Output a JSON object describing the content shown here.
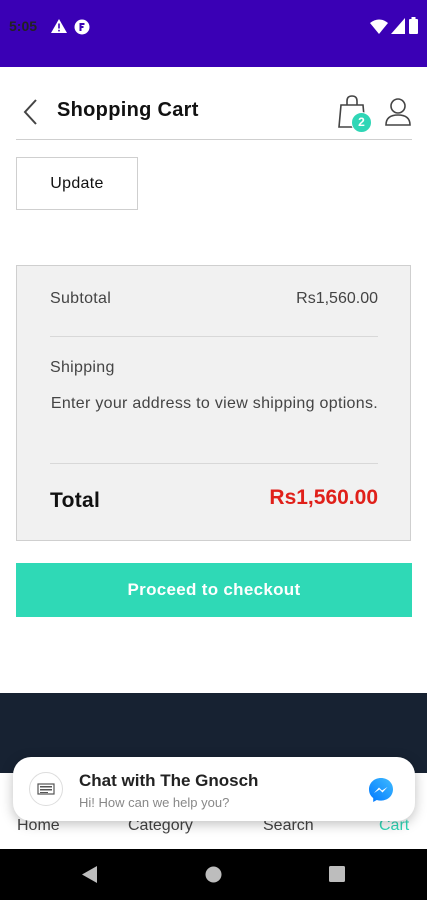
{
  "status_bar": {
    "time": "5:05"
  },
  "header": {
    "title": "Shopping Cart",
    "cart_count": "2"
  },
  "cart": {
    "update_label": "Update"
  },
  "totals": {
    "subtotal_label": "Subtotal",
    "subtotal_value": "Rs1,560.00",
    "shipping_label": "Shipping",
    "shipping_note": "Enter your address to view shipping options.",
    "total_label": "Total",
    "total_value": "Rs1,560.00"
  },
  "checkout": {
    "label": "Proceed to checkout"
  },
  "bottom_nav": {
    "items": [
      {
        "label": "Home"
      },
      {
        "label": "Category"
      },
      {
        "label": "Search"
      },
      {
        "label": "Cart"
      }
    ],
    "active": "Cart"
  },
  "chat": {
    "title": "Chat with The Gnosch",
    "subtitle": "Hi! How can we help you?"
  },
  "colors": {
    "status_bar": "#3a00b5",
    "accent": "#2fd9b6",
    "total_price": "#e0201a",
    "footer": "#172232"
  },
  "icons": {
    "back": "chevron-left-icon",
    "cart": "shopping-bag-icon",
    "user": "user-icon",
    "messenger": "messenger-icon"
  }
}
